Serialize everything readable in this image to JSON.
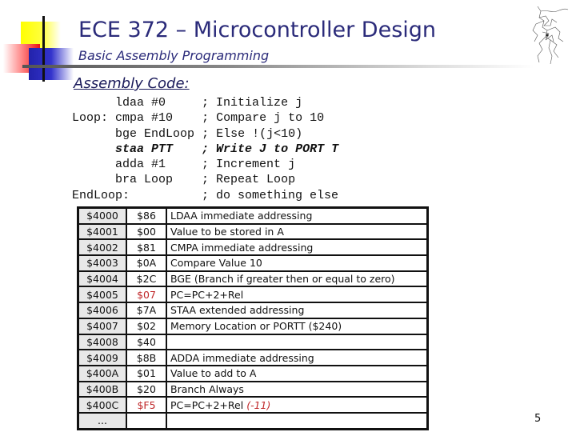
{
  "header": {
    "title": "ECE 372 – Microcontroller Design",
    "subtitle": "Basic Assembly Programming"
  },
  "section_heading": "Assembly Code:",
  "code_lines": [
    {
      "label": "",
      "instr": "ldaa #0",
      "comment": "; Initialize j",
      "emphasis": false
    },
    {
      "label": "Loop:",
      "instr": "cmpa #10",
      "comment": "; Compare j to 10",
      "emphasis": false
    },
    {
      "label": "",
      "instr": "bge EndLoop",
      "comment": "; Else !(j<10)",
      "emphasis": false
    },
    {
      "label": "",
      "instr": "staa PTT",
      "comment": "; Write J to PORT T",
      "emphasis": true
    },
    {
      "label": "",
      "instr": "adda #1",
      "comment": "; Increment j",
      "emphasis": false
    },
    {
      "label": "",
      "instr": "bra Loop",
      "comment": "; Repeat Loop",
      "emphasis": false
    },
    {
      "label": "EndLoop:",
      "instr": "",
      "comment": "; do something else",
      "emphasis": false
    }
  ],
  "memory_table": {
    "rows": [
      {
        "address": "$4000",
        "value": "$86",
        "description": "LDAA immediate addressing",
        "value_highlight": false,
        "note": ""
      },
      {
        "address": "$4001",
        "value": "$00",
        "description": "Value to be stored in A",
        "value_highlight": false,
        "note": ""
      },
      {
        "address": "$4002",
        "value": "$81",
        "description": "CMPA immediate addressing",
        "value_highlight": false,
        "note": ""
      },
      {
        "address": "$4003",
        "value": "$0A",
        "description": "Compare Value 10",
        "value_highlight": false,
        "note": ""
      },
      {
        "address": "$4004",
        "value": "$2C",
        "description": "BGE (Branch if greater then or equal to zero)",
        "value_highlight": false,
        "note": ""
      },
      {
        "address": "$4005",
        "value": "$07",
        "description": "PC=PC+2+Rel",
        "value_highlight": true,
        "note": ""
      },
      {
        "address": "$4006",
        "value": "$7A",
        "description": "STAA extended addressing",
        "value_highlight": false,
        "note": ""
      },
      {
        "address": "$4007",
        "value": "$02",
        "description": "Memory Location or PORTT ($240)",
        "value_highlight": false,
        "note": ""
      },
      {
        "address": "$4008",
        "value": "$40",
        "description": "",
        "value_highlight": false,
        "note": ""
      },
      {
        "address": "$4009",
        "value": "$8B",
        "description": "ADDA immediate addressing",
        "value_highlight": false,
        "note": ""
      },
      {
        "address": "$400A",
        "value": "$01",
        "description": "Value to add to A",
        "value_highlight": false,
        "note": ""
      },
      {
        "address": "$400B",
        "value": "$20",
        "description": "Branch Always",
        "value_highlight": false,
        "note": ""
      },
      {
        "address": "$400C",
        "value": "$F5",
        "description": "PC=PC+2+Rel",
        "value_highlight": true,
        "note": "(-11)"
      },
      {
        "address": "...",
        "value": "",
        "description": "",
        "value_highlight": false,
        "note": ""
      }
    ]
  },
  "colors": {
    "title": "#2b2b7a",
    "highlight_red": "#c0282a",
    "address_cell_bg": "#e8e8e8"
  },
  "icons": {
    "logo": "squares-crosshair-logo",
    "sketch": "line-drawing-illustration"
  },
  "page_number": "5"
}
